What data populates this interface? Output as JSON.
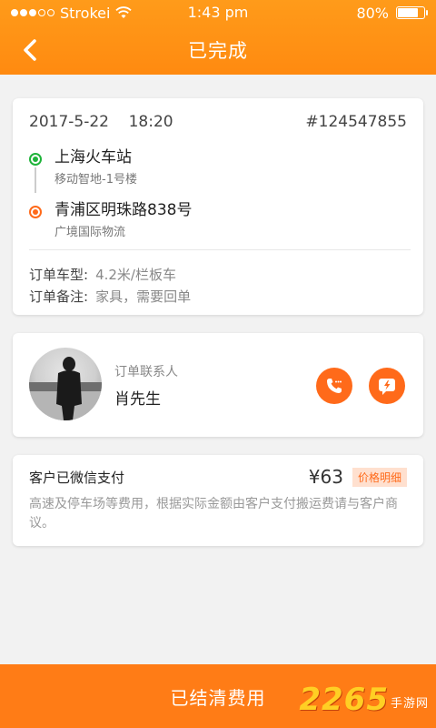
{
  "status_bar": {
    "carrier": "Strokei",
    "time": "1:43 pm",
    "battery": "80%",
    "battery_level": 0.8
  },
  "nav": {
    "title": "已完成",
    "back_icon": "chevron-left-icon"
  },
  "order": {
    "date": "2017-5-22",
    "time": "18:20",
    "number": "#124547855",
    "from": {
      "name": "上海火车站",
      "detail": "移动智地-1号楼"
    },
    "to": {
      "name": "青浦区明珠路838号",
      "detail": "广境国际物流"
    },
    "vehicle_label": "订单车型:",
    "vehicle_value": "4.2米/栏板车",
    "note_label": "订单备注:",
    "note_value": "家具，需要回单"
  },
  "contact": {
    "label": "订单联系人",
    "name": "肖先生",
    "call_icon": "phone-icon",
    "message_icon": "message-icon"
  },
  "payment": {
    "title": "客户已微信支付",
    "price": "¥63",
    "detail_tag": "价格明细",
    "desc": "高速及停车场等费用，根据实际金额由客户支付搬运费请与客户商议。"
  },
  "bottom": {
    "button_label": "已结清费用"
  },
  "watermark": {
    "number": "2265",
    "text": "手游网"
  },
  "colors": {
    "header": "#ff9b1a",
    "accent": "#ff6a1a",
    "start_pin": "#1fb33a",
    "end_pin": "#ff6a1a"
  }
}
